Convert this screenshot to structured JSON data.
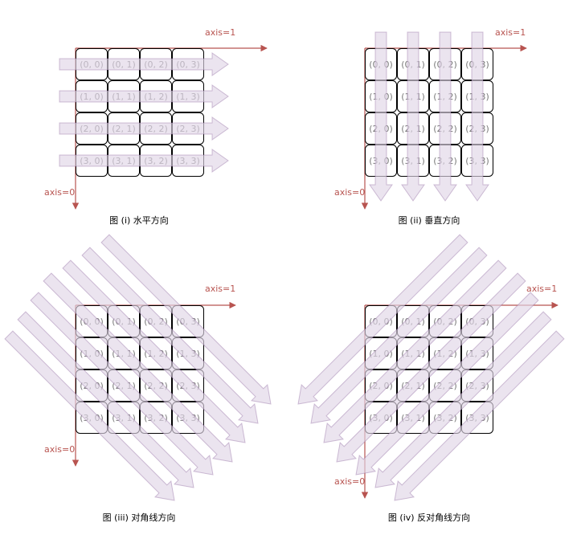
{
  "cells": [
    [
      "(0, 0)",
      "(0, 1)",
      "(0, 2)",
      "(0, 3)"
    ],
    [
      "(1, 0)",
      "(1, 1)",
      "(1, 2)",
      "(1, 3)"
    ],
    [
      "(2, 0)",
      "(2, 1)",
      "(2, 2)",
      "(2, 3)"
    ],
    [
      "(3, 0)",
      "(3, 1)",
      "(3, 2)",
      "(3, 3)"
    ]
  ],
  "axis0_label": "axis=0",
  "axis1_label": "axis=1",
  "panels": [
    {
      "id": "horizontal",
      "caption": "图 (i) 水平方向",
      "direction": "horizontal"
    },
    {
      "id": "vertical",
      "caption": "图 (ii) 垂直方向",
      "direction": "vertical"
    },
    {
      "id": "diagonal",
      "caption": "图 (iii) 对角线方向",
      "direction": "diagonal"
    },
    {
      "id": "anti-diagonal",
      "caption": "图 (iv) 反对角线方向",
      "direction": "anti-diagonal"
    }
  ],
  "colors": {
    "axis": "#b85450",
    "arrow_fill": "#e1d5e7",
    "arrow_stroke": "#9673a6",
    "cell_border": "#000000",
    "cell_text": "#7a7a7a"
  }
}
